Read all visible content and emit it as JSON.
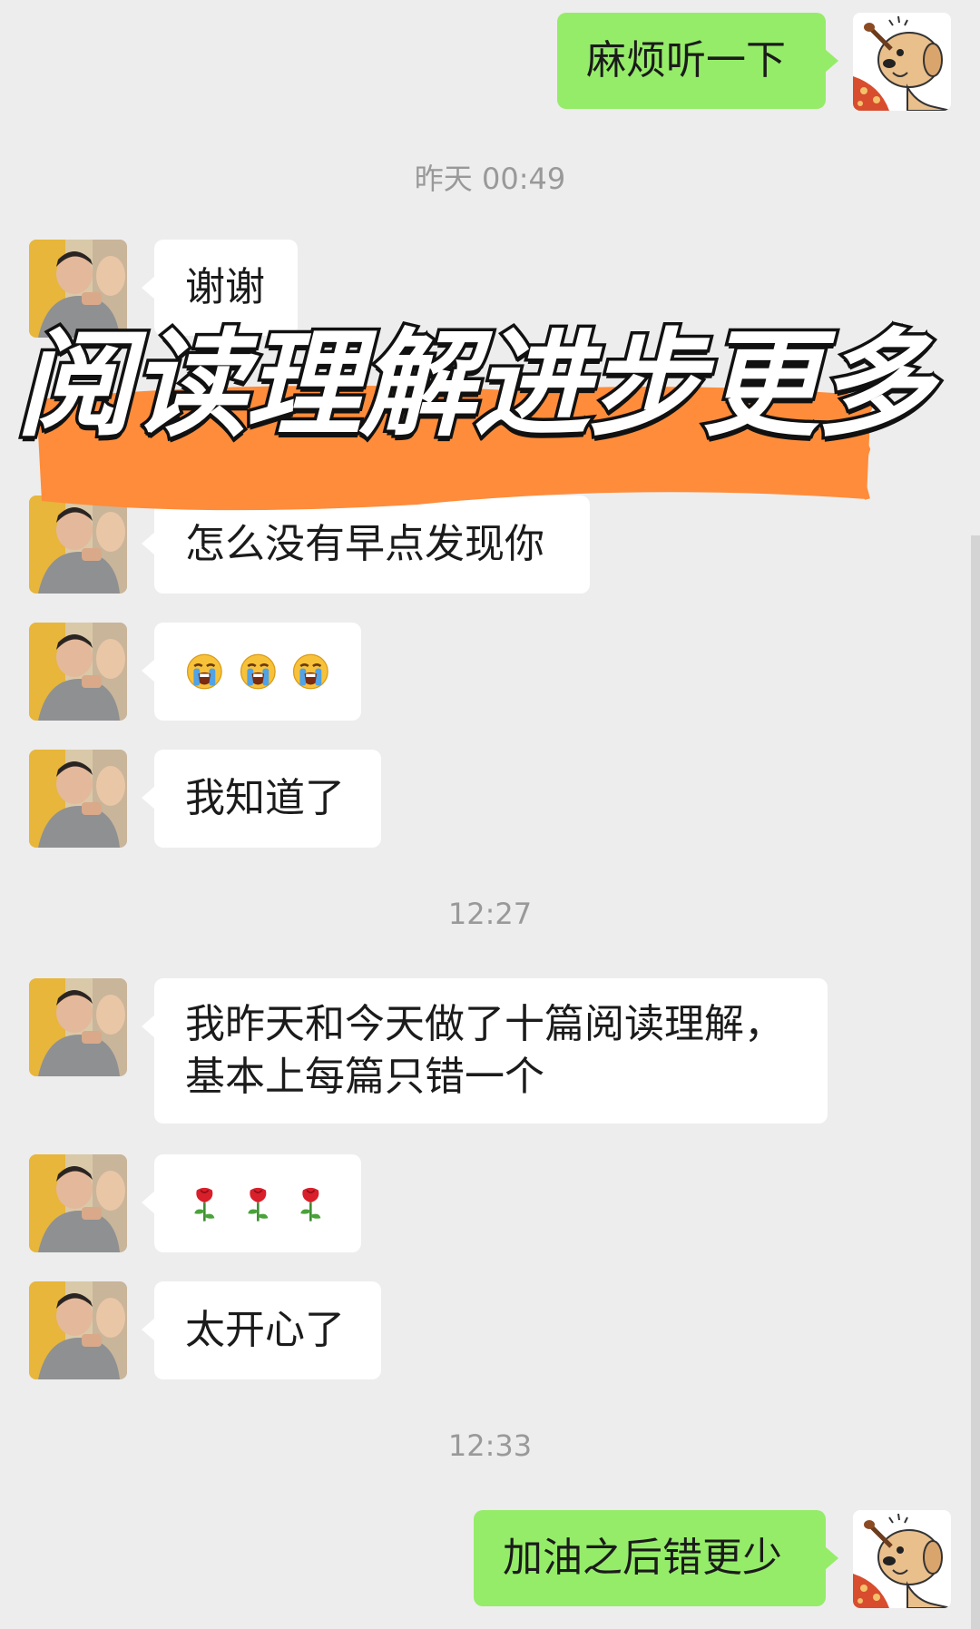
{
  "messages": {
    "m1": "麻烦听一下",
    "m2": "谢谢",
    "m3": "怎么没有早点发现你",
    "m5": "我知道了",
    "m6_line1": "我昨天和今天做了十篇阅读理解，",
    "m6_line2": "基本上每篇只错一个",
    "m8": "太开心了",
    "m9": "加油之后错更少"
  },
  "timestamps": {
    "t1": "昨天 00:49",
    "t2": "12:27",
    "t3": "12:33"
  },
  "banner": {
    "text": "阅读理解进步更多",
    "highlight_color": "#ff8c3a"
  },
  "icons": {
    "crying": "loudly-crying-face",
    "flower": "rose"
  },
  "colors": {
    "background": "#ededed",
    "outgoing_bubble": "#95ec69",
    "incoming_bubble": "#ffffff"
  }
}
